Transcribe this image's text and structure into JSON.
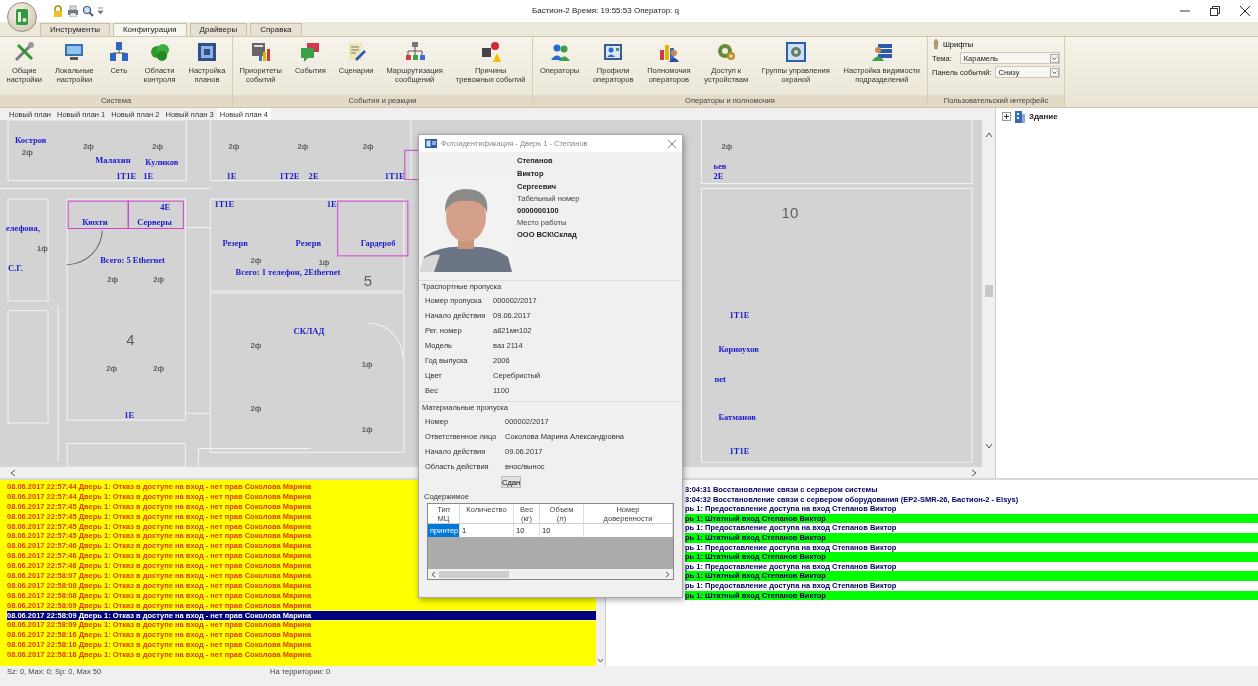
{
  "window": {
    "title": "Бастион-2 Время: 19:55:53 Оператор: q"
  },
  "ribbon": {
    "tabs": [
      {
        "label": "Инструменты",
        "selected": false
      },
      {
        "label": "Конфигурация",
        "selected": true
      },
      {
        "label": "Драйверы",
        "selected": false
      },
      {
        "label": "Справка",
        "selected": false
      }
    ],
    "groups": [
      {
        "title": "Система",
        "buttons": [
          "Общие\nнастройки",
          "Локальные\nнастройки",
          "Сеть",
          "Области\nконтроля",
          "Настройка\nпланов"
        ]
      },
      {
        "title": "События и реакции",
        "buttons": [
          "Приоритеты\nсобытий",
          "События",
          "Сценарии",
          "Маршрутизация\nсообщений",
          "Причины\nтревожных событий"
        ]
      },
      {
        "title": "Операторы и полномочия",
        "buttons": [
          "Операторы",
          "Профили\nоператоров",
          "Полномочия\nоператоров",
          "Доступ к\nустройствам",
          "Группы управления\nохраной",
          "Настройка видимости\nподразделений"
        ]
      }
    ],
    "ui_group": {
      "title": "Пользовательский интерфейс",
      "fonts_button": "Шрифты",
      "theme_label": "Тема:",
      "theme_value": "Карамель",
      "panel_label": "Панель событий:",
      "panel_value": "Снизу"
    }
  },
  "doc_tabs": [
    {
      "label": "Новый план",
      "selected": false
    },
    {
      "label": "Новый план 1",
      "selected": false
    },
    {
      "label": "Новый план 2",
      "selected": false
    },
    {
      "label": "Новый план 3",
      "selected": false
    },
    {
      "label": "Новый план 4",
      "selected": true
    }
  ],
  "plan": {
    "labels": [
      {
        "text": "Костров",
        "kind": "name"
      },
      {
        "text": "2ф",
        "kind": "socket"
      },
      {
        "text": "2ф",
        "kind": "socket"
      },
      {
        "text": "2ф",
        "kind": "socket"
      },
      {
        "text": "2ф",
        "kind": "socket"
      },
      {
        "text": "2ф",
        "kind": "socket"
      },
      {
        "text": "2ф",
        "kind": "socket"
      },
      {
        "text": "2ф",
        "kind": "socket"
      },
      {
        "text": "Малахин",
        "kind": "name"
      },
      {
        "text": "Куликов",
        "kind": "name"
      },
      {
        "text": "ьев",
        "kind": "name"
      },
      {
        "text": "1Т1Е",
        "kind": "name"
      },
      {
        "text": "1Е",
        "kind": "name"
      },
      {
        "text": "1Е",
        "kind": "name"
      },
      {
        "text": "1Т2Е",
        "kind": "name"
      },
      {
        "text": "2Е",
        "kind": "name"
      },
      {
        "text": "1Т1Е",
        "kind": "name"
      },
      {
        "text": "2Е",
        "kind": "name"
      },
      {
        "text": "1Т1Е",
        "kind": "name"
      },
      {
        "text": "1Е",
        "kind": "name"
      },
      {
        "text": "4Е",
        "kind": "name"
      },
      {
        "text": "10",
        "kind": "room"
      },
      {
        "text": "Кюхти",
        "kind": "name"
      },
      {
        "text": "Серверы",
        "kind": "name"
      },
      {
        "text": "елефона,",
        "kind": "name"
      },
      {
        "text": "Резерв",
        "kind": "name"
      },
      {
        "text": "Резерв",
        "kind": "name"
      },
      {
        "text": "Гардероб",
        "kind": "name"
      },
      {
        "text": "1ф",
        "kind": "socket"
      },
      {
        "text": "Всего: 5 Ethernet",
        "kind": "name"
      },
      {
        "text": "2ф",
        "kind": "socket"
      },
      {
        "text": "1ф",
        "kind": "socket"
      },
      {
        "text": "С.Г.",
        "kind": "name"
      },
      {
        "text": "Всего: 1 телефон, 2Ethernet",
        "kind": "name"
      },
      {
        "text": "2ф",
        "kind": "socket"
      },
      {
        "text": "2ф",
        "kind": "socket"
      },
      {
        "text": "5",
        "kind": "room"
      },
      {
        "text": "1Т1Е",
        "kind": "name"
      },
      {
        "text": "СКЛАД",
        "kind": "name"
      },
      {
        "text": "4",
        "kind": "room"
      },
      {
        "text": "2ф",
        "kind": "socket"
      },
      {
        "text": "Корноухов",
        "kind": "name"
      },
      {
        "text": "1ф",
        "kind": "socket"
      },
      {
        "text": "2ф",
        "kind": "socket"
      },
      {
        "text": "2ф",
        "kind": "socket"
      },
      {
        "text": "net",
        "kind": "name"
      },
      {
        "text": "2ф",
        "kind": "socket"
      },
      {
        "text": "1Е",
        "kind": "name"
      },
      {
        "text": "Батманов",
        "kind": "name"
      },
      {
        "text": "1ф",
        "kind": "socket"
      },
      {
        "text": "1Т1Е",
        "kind": "name"
      }
    ]
  },
  "tree": [
    {
      "label": "Здание",
      "expanded": false
    }
  ],
  "dialog": {
    "title": "Фотоидентификация - Дверь 1 - Степанов",
    "person": {
      "surname": "Степанов",
      "name": "Виктор",
      "patronymic": "Сергеевич",
      "id_label": "Табельный номер",
      "id_value": "0000000100",
      "work_label": "Место работы",
      "work_value": "ООО ВСК\\Склад"
    },
    "transport": {
      "title": "Траспортные пропуска",
      "fields": [
        {
          "label": "Номер пропуска",
          "value": "000002/2017"
        },
        {
          "label": "Начало действия",
          "value": "09.06.2017"
        },
        {
          "label": "Рег. номер",
          "value": "а821мн102"
        },
        {
          "label": "Модель",
          "value": "ваз 2114"
        },
        {
          "label": "Год выпуска",
          "value": "2006"
        },
        {
          "label": "Цвет",
          "value": "Серебристый"
        },
        {
          "label": "Вес",
          "value": "1100"
        }
      ]
    },
    "material": {
      "title": "Материальные пропуска",
      "fields": [
        {
          "label": "Номер",
          "value": "000002/2017"
        },
        {
          "label": "Ответственное лицо",
          "value": "Соколова Марина Александровна"
        },
        {
          "label": "Начало действия",
          "value": "09.06.2017"
        },
        {
          "label": "Область действия",
          "value": "внос/вынос"
        }
      ],
      "button": "Сдан"
    },
    "contents": {
      "title": "Содержимое",
      "columns": [
        "Тип\nМЦ",
        "Количество",
        "Вес\n(кг)",
        "Объем\n(л)",
        "Номер\nдоверенности"
      ],
      "rows": [
        {
          "cells": [
            "принтер",
            "1",
            "10",
            "10"
          ],
          "selected": true
        }
      ]
    }
  },
  "log_left": [
    {
      "text": "08.06.2017 22:57:44 Дверь 1: Отказ в доступе на вход - нет прав  Соколова Марина",
      "selected": false
    },
    {
      "text": "08.06.2017 22:57:44 Дверь 1: Отказ в доступе на вход - нет прав  Соколова Марина",
      "selected": false
    },
    {
      "text": "08.06.2017 22:57:45 Дверь 1: Отказ в доступе на вход - нет прав  Соколова Марина",
      "selected": false
    },
    {
      "text": "08.06.2017 22:57:45 Дверь 1: Отказ в доступе на вход - нет прав  Соколова Марина",
      "selected": false
    },
    {
      "text": "08.06.2017 22:57:45 Дверь 1: Отказ в доступе на вход - нет прав  Соколова Марина",
      "selected": false
    },
    {
      "text": "08.06.2017 22:57:45 Дверь 1: Отказ в доступе на вход - нет прав  Соколова Марина",
      "selected": false
    },
    {
      "text": "08.06.2017 22:57:46 Дверь 1: Отказ в доступе на вход - нет прав  Соколова Марина",
      "selected": false
    },
    {
      "text": "08.06.2017 22:57:46 Дверь 1: Отказ в доступе на вход - нет прав  Соколова Марина",
      "selected": false
    },
    {
      "text": "08.06.2017 22:57:46 Дверь 1: Отказ в доступе на вход - нет прав  Соколова Марина",
      "selected": false
    },
    {
      "text": "08.06.2017 22:58:07 Дверь 1: Отказ в доступе на вход - нет прав  Соколова Марина",
      "selected": false
    },
    {
      "text": "08.06.2017 22:58:08 Дверь 1: Отказ в доступе на вход - нет прав  Соколова Марина",
      "selected": false
    },
    {
      "text": "08.06.2017 22:58:08 Дверь 1: Отказ в доступе на вход - нет прав  Соколова Марина",
      "selected": false
    },
    {
      "text": "08.06.2017 22:58:09 Дверь 1: Отказ в доступе на вход - нет прав  Соколова Марина",
      "selected": false
    },
    {
      "text": "08.06.2017 22:58:09 Дверь 1: Отказ в доступе на вход - нет прав  Соколова Марина",
      "selected": true
    },
    {
      "text": "08.06.2017 22:58:09 Дверь 1: Отказ в доступе на вход - нет прав  Соколова Марина",
      "selected": false
    },
    {
      "text": "08.06.2017 22:58:16 Дверь 1: Отказ в доступе на вход - нет прав  Соколова Марина",
      "selected": false
    },
    {
      "text": "08.06.2017 22:58:16 Дверь 1: Отказ в доступе на вход - нет прав  Соколова Марина",
      "selected": false
    },
    {
      "text": "08.06.2017 22:58:16 Дверь 1: Отказ в доступе на вход - нет прав  Соколова Марина",
      "selected": false
    }
  ],
  "log_right": [
    {
      "text": "3:04:31 Восстановление связи с сервером системы",
      "color": "#ffffff"
    },
    {
      "text": "3:04:32 Восстановление связи с сервером оборудования (EP2-SMR-26, Бастион-2 - Elsys)",
      "color": "#ffffff"
    },
    {
      "text": "рь 1: Предоставление доступа на вход Степанов Виктор",
      "color": "#ffffff"
    },
    {
      "text": "рь 1: Штатный вход Степанов Виктор",
      "color": "#00ff00"
    },
    {
      "text": "рь 1: Предоставление доступа на вход Степанов Виктор",
      "color": "#ffffff"
    },
    {
      "text": "рь 1: Штатный вход Степанов Виктор",
      "color": "#00ff00"
    },
    {
      "text": "рь 1: Предоставление доступа на вход Степанов Виктор",
      "color": "#ffffff"
    },
    {
      "text": "рь 1: Штатный вход Степанов Виктор",
      "color": "#00ff00"
    },
    {
      "text": "рь 1: Предоставление доступа на вход Степанов Виктор",
      "color": "#ffffff"
    },
    {
      "text": "рь 1: Штатный вход Степанов Виктор",
      "color": "#00ff00"
    },
    {
      "text": "рь 1: Предоставление доступа на вход Степанов Виктор",
      "color": "#ffffff"
    },
    {
      "text": "рь 1: Штатный вход Степанов Виктор",
      "color": "#00ff00"
    }
  ],
  "status_bar": [
    "Sz: 0, Max: 0; Sp: 0, Max 50",
    "На территории: 0"
  ]
}
